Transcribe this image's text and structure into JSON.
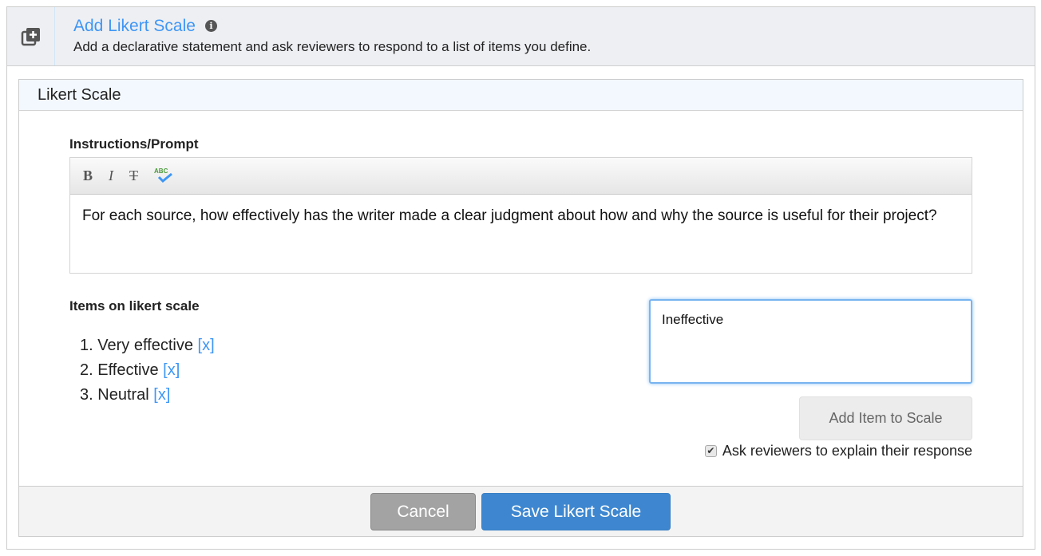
{
  "header": {
    "title": "Add Likert Scale",
    "info_icon": "info-icon",
    "subtitle": "Add a declarative statement and ask reviewers to respond to a list of items you define.",
    "icon": "add-to-library-icon"
  },
  "panel": {
    "title": "Likert Scale"
  },
  "prompt": {
    "label": "Instructions/Prompt",
    "toolbar": {
      "bold": "B",
      "italic": "I",
      "strike": "T",
      "spellcheck": "ABC"
    },
    "text": "For each source, how effectively has the writer made a clear judgment about how and why the source is useful for their project?"
  },
  "items": {
    "label": "Items on likert scale",
    "remove_label": "[x]",
    "list": [
      {
        "num": "1.",
        "text": "Very effective"
      },
      {
        "num": "2.",
        "text": "Effective"
      },
      {
        "num": "3.",
        "text": "Neutral"
      }
    ]
  },
  "new_item": {
    "value": "Ineffective",
    "add_button": "Add Item to Scale"
  },
  "explain": {
    "label": "Ask reviewers to explain their response",
    "checked": true
  },
  "footer": {
    "cancel": "Cancel",
    "save": "Save Likert Scale"
  },
  "colors": {
    "accent": "#3d96f5",
    "save": "#3e87d0",
    "cancel": "#a3a3a3"
  }
}
